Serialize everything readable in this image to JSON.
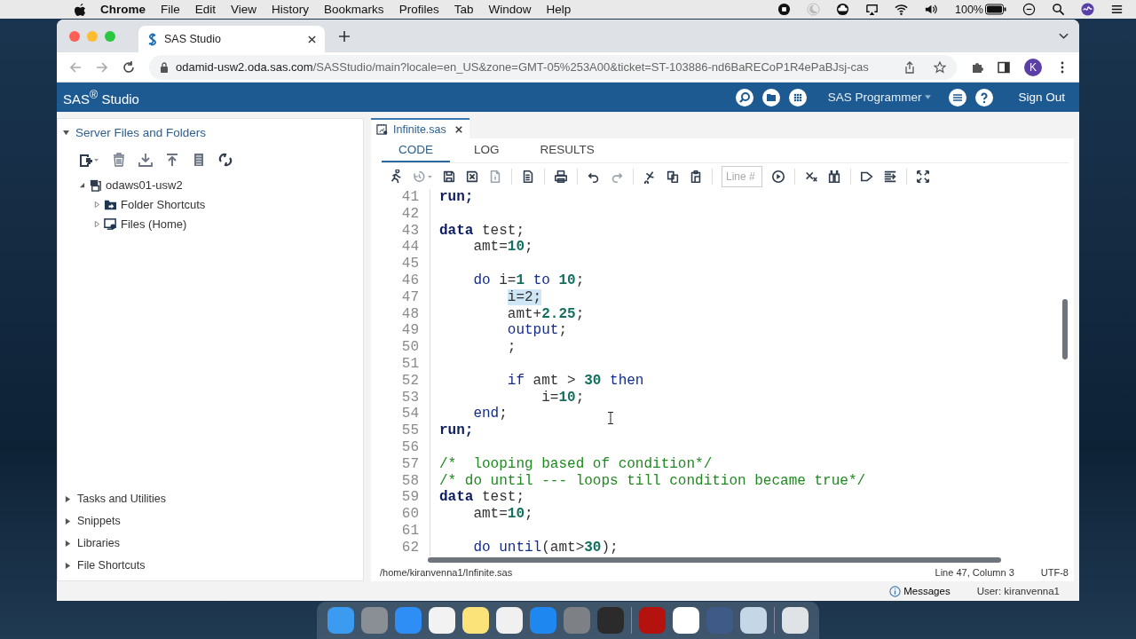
{
  "menu_bar": {
    "app": "Chrome",
    "items": [
      "File",
      "Edit",
      "View",
      "History",
      "Bookmarks",
      "Profiles",
      "Tab",
      "Window",
      "Help"
    ],
    "battery": "100%"
  },
  "browser": {
    "tab": {
      "title": "SAS Studio"
    },
    "url_host": "odamid-usw2.oda.sas.com",
    "url_path": "/SASStudio/main?locale=en_US&zone=GMT-05%253A00&ticket=ST-103886-nd6BaRECoP1R4ePaBJsj-cas",
    "profile": "K"
  },
  "header": {
    "title": "SAS$^{®}$ Studio",
    "perspective": "SAS Programmer",
    "sign_out": "Sign Out"
  },
  "sidebar": {
    "title": "Server Files and Folders",
    "expanded": true,
    "tree": [
      {
        "label": "odaws01-usw2",
        "kind": "server",
        "expanded": true,
        "children": [
          {
            "label": "Folder Shortcuts",
            "kind": "shortcuts",
            "expanded": false
          },
          {
            "label": "Files (Home)",
            "kind": "home",
            "expanded": false
          }
        ]
      }
    ],
    "sections": [
      {
        "label": "Tasks and Utilities",
        "expanded": false
      },
      {
        "label": "Snippets",
        "expanded": false
      },
      {
        "label": "Libraries",
        "expanded": false
      },
      {
        "label": "File Shortcuts",
        "expanded": false
      }
    ]
  },
  "editor": {
    "file_tab": "Infinite.sas",
    "tabs": [
      {
        "label": "CODE",
        "selected": true
      },
      {
        "label": "LOG",
        "selected": false
      },
      {
        "label": "RESULTS",
        "selected": false
      }
    ],
    "line_field": {
      "placeholder": "Line #"
    },
    "lines": [
      {
        "number": "41",
        "tokens": [
          {
            "kind": "keyword",
            "text": "run;"
          }
        ]
      },
      {
        "number": "42"
      },
      {
        "number": "43",
        "tokens": [
          {
            "kind": "keyword",
            "text": "data"
          },
          {
            "kind": "plain",
            "text": " test;"
          }
        ]
      },
      {
        "number": "44",
        "tokens": [
          {
            "kind": "plain",
            "text": "    amt="
          },
          {
            "kind": "number",
            "text": "10"
          },
          {
            "kind": "plain",
            "text": ";"
          }
        ]
      },
      {
        "number": "45"
      },
      {
        "number": "46",
        "tokens": [
          {
            "kind": "statement",
            "text": "    do"
          },
          {
            "kind": "plain",
            "text": " i="
          },
          {
            "kind": "number",
            "text": "1"
          },
          {
            "kind": "statement",
            "text": " to"
          },
          {
            "kind": "number",
            "text": " 10"
          },
          {
            "kind": "plain",
            "text": ";"
          }
        ]
      },
      {
        "number": "47",
        "tokens": [
          {
            "kind": "selected",
            "text": "i=2;"
          }
        ]
      },
      {
        "number": "48",
        "tokens": [
          {
            "kind": "plain",
            "text": "        amt+"
          },
          {
            "kind": "number",
            "text": "2.25"
          },
          {
            "kind": "plain",
            "text": ";"
          }
        ]
      },
      {
        "number": "49",
        "tokens": [
          {
            "kind": "statement",
            "text": "        output"
          },
          {
            "kind": "plain",
            "text": ";"
          }
        ]
      },
      {
        "number": "50",
        "tokens": [
          {
            "kind": "plain",
            "text": "        ;"
          }
        ]
      },
      {
        "number": "51"
      },
      {
        "number": "52",
        "tokens": [
          {
            "kind": "statement",
            "text": "        if"
          },
          {
            "kind": "plain",
            "text": " amt > "
          },
          {
            "kind": "number",
            "text": "30"
          },
          {
            "kind": "statement",
            "text": " then"
          }
        ]
      },
      {
        "number": "53",
        "tokens": [
          {
            "kind": "plain",
            "text": "            i="
          },
          {
            "kind": "number",
            "text": "10"
          },
          {
            "kind": "plain",
            "text": ";"
          }
        ]
      },
      {
        "number": "54",
        "tokens": [
          {
            "kind": "statement",
            "text": "    end"
          },
          {
            "kind": "plain",
            "text": ";"
          }
        ]
      },
      {
        "number": "55",
        "tokens": [
          {
            "kind": "keyword",
            "text": "run;"
          }
        ]
      },
      {
        "number": "56"
      },
      {
        "number": "57",
        "tokens": [
          {
            "kind": "comment",
            "text": "/*  looping based of condition*/"
          }
        ]
      },
      {
        "number": "58",
        "tokens": [
          {
            "kind": "comment",
            "text": "/* do until --- loops till condition became true*/"
          }
        ]
      },
      {
        "number": "59",
        "tokens": [
          {
            "kind": "keyword",
            "text": "data"
          },
          {
            "kind": "plain",
            "text": " test;"
          }
        ]
      },
      {
        "number": "60",
        "tokens": [
          {
            "kind": "plain",
            "text": "    amt="
          },
          {
            "kind": "number",
            "text": "10"
          },
          {
            "kind": "plain",
            "text": ";"
          }
        ]
      },
      {
        "number": "61"
      },
      {
        "number": "62",
        "tokens": [
          {
            "kind": "statement",
            "text": "    do until"
          },
          {
            "kind": "plain",
            "text": "(amt>"
          },
          {
            "kind": "number",
            "text": "30"
          },
          {
            "kind": "plain",
            "text": ");"
          }
        ]
      }
    ],
    "path": "/home/kiranvenna1/Infinite.sas",
    "position": "Line 47, Column 3",
    "encoding": "UTF-8"
  },
  "footer": {
    "messages": "Messages",
    "user": "User: kiranvenna1"
  }
}
